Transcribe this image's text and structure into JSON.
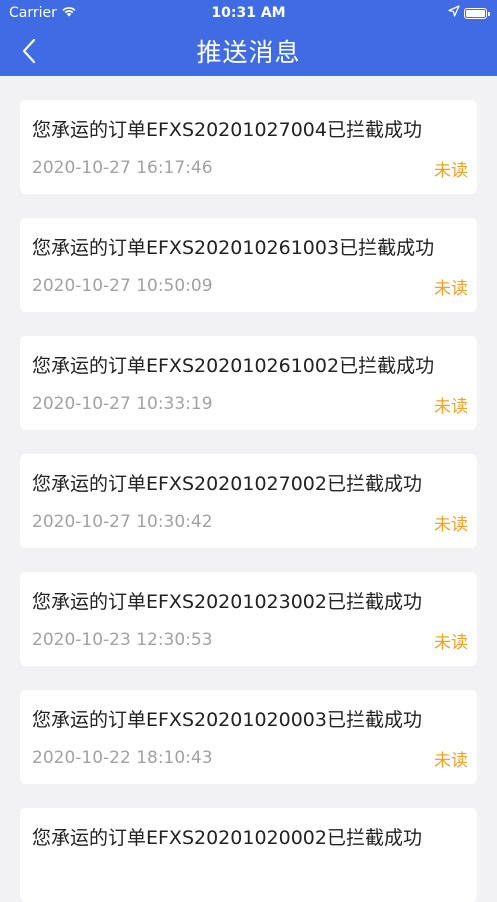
{
  "status_bar": {
    "carrier": "Carrier",
    "time": "10:31 AM"
  },
  "header": {
    "title": "推送消息"
  },
  "messages": [
    {
      "text": "您承运的订单EFXS20201027004已拦截成功",
      "time": "2020-10-27 16:17:46",
      "status": "未读"
    },
    {
      "text": "您承运的订单EFXS202010261003已拦截成功",
      "time": "2020-10-27 10:50:09",
      "status": "未读"
    },
    {
      "text": "您承运的订单EFXS202010261002已拦截成功",
      "time": "2020-10-27 10:33:19",
      "status": "未读"
    },
    {
      "text": "您承运的订单EFXS20201027002已拦截成功",
      "time": "2020-10-27 10:30:42",
      "status": "未读"
    },
    {
      "text": "您承运的订单EFXS20201023002已拦截成功",
      "time": "2020-10-23 12:30:53",
      "status": "未读"
    },
    {
      "text": "您承运的订单EFXS20201020003已拦截成功",
      "time": "2020-10-22 18:10:43",
      "status": "未读"
    },
    {
      "text": "您承运的订单EFXS20201020002已拦截成功",
      "time": "",
      "status": ""
    }
  ],
  "colors": {
    "header_bg": "#3f6be3",
    "unread": "#f2a227",
    "timestamp": "#a2a2a6"
  }
}
